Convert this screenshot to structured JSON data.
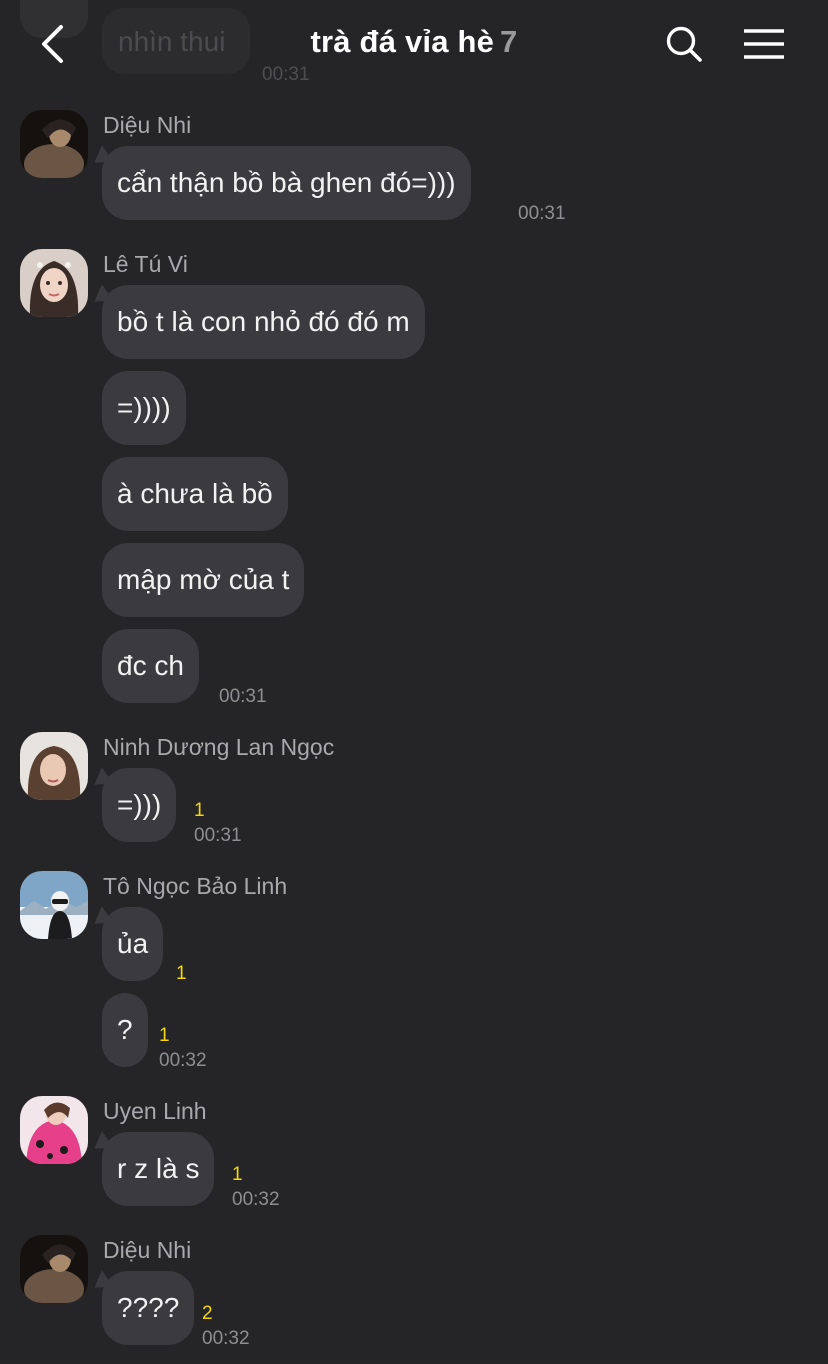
{
  "header": {
    "title": "trà đá vỉa hè",
    "member_count": "7"
  },
  "partial_message": {
    "text": "nhìn thui",
    "time": "00:31"
  },
  "messages": [
    {
      "sender": "Diệu Nhi",
      "bubbles": [
        {
          "text": "cẩn thận bồ bà ghen đó=)))",
          "time": "00:31"
        }
      ]
    },
    {
      "sender": "Lê Tú Vi",
      "bubbles": [
        {
          "text": "bồ t là con nhỏ đó đó m"
        },
        {
          "text": "=))))"
        },
        {
          "text": "à chưa là bồ"
        },
        {
          "text": "mập mờ của t"
        },
        {
          "text": "đc ch",
          "time": "00:31"
        }
      ]
    },
    {
      "sender": "Ninh Dương Lan Ngọc",
      "bubbles": [
        {
          "text": "=)))",
          "unread": "1",
          "time": "00:31"
        }
      ]
    },
    {
      "sender": "Tô Ngọc Bảo Linh",
      "bubbles": [
        {
          "text": "ủa",
          "unread": "1"
        },
        {
          "text": "?",
          "unread": "1",
          "time": "00:32"
        }
      ]
    },
    {
      "sender": "Uyen Linh",
      "bubbles": [
        {
          "text": "r z là s",
          "unread": "1",
          "time": "00:32"
        }
      ]
    },
    {
      "sender": "Diệu Nhi",
      "bubbles": [
        {
          "text": "????",
          "unread": "2",
          "time": "00:32"
        }
      ]
    }
  ],
  "colors": {
    "background": "#252528",
    "bubble": "#3b3b3f",
    "unread_count": "#f5d60b",
    "timestamp": "#8e8e92"
  },
  "icons": [
    "back-arrow-icon",
    "search-icon",
    "menu-icon"
  ]
}
